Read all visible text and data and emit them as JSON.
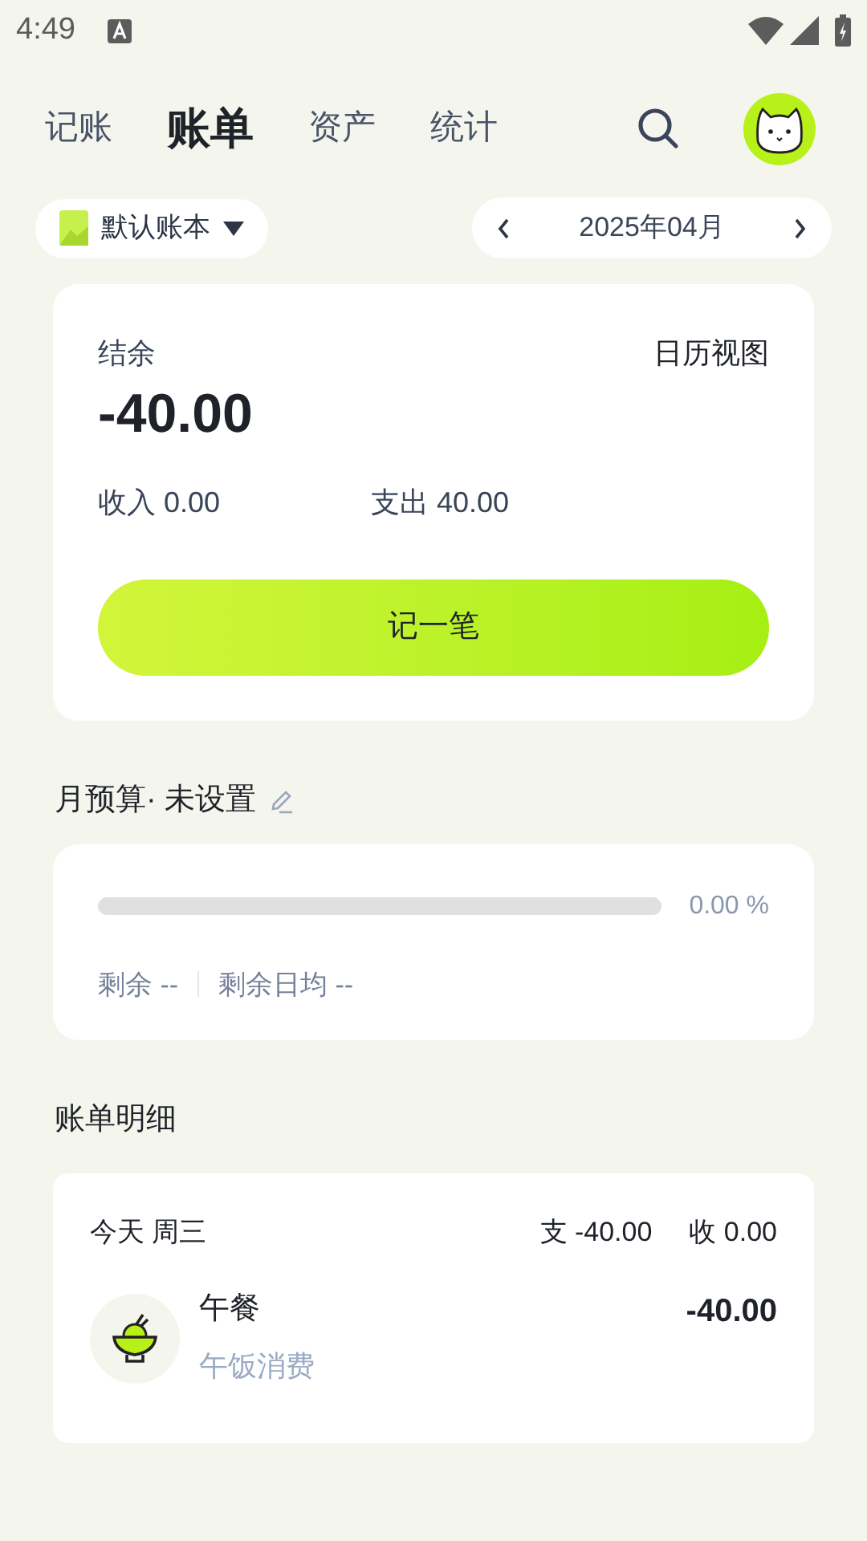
{
  "status_bar": {
    "time": "4:49"
  },
  "tabs": [
    {
      "label": "记账",
      "selected": false
    },
    {
      "label": "账单",
      "selected": true
    },
    {
      "label": "资产",
      "selected": false
    },
    {
      "label": "统计",
      "selected": false
    }
  ],
  "ledger": {
    "label": "默认账本"
  },
  "month": {
    "label": "2025年04月"
  },
  "summary": {
    "balance_label": "结余",
    "view_link": "日历视图",
    "balance": "-40.00",
    "income": "收入 0.00",
    "expense": "支出 40.00",
    "add_button": "记一笔"
  },
  "budget": {
    "title": "月预算· 未设置",
    "level": 0,
    "percent": "0.00 %",
    "remaining": "剩余 --",
    "daily": "剩余日均 --"
  },
  "details": {
    "title": "账单明细",
    "days": [
      {
        "date": "今天 周三",
        "expense": "支 -40.00",
        "income": "收 0.00",
        "entries": [
          {
            "name": "午餐",
            "note": "午饭消费",
            "amount": "-40.00"
          }
        ]
      }
    ]
  }
}
